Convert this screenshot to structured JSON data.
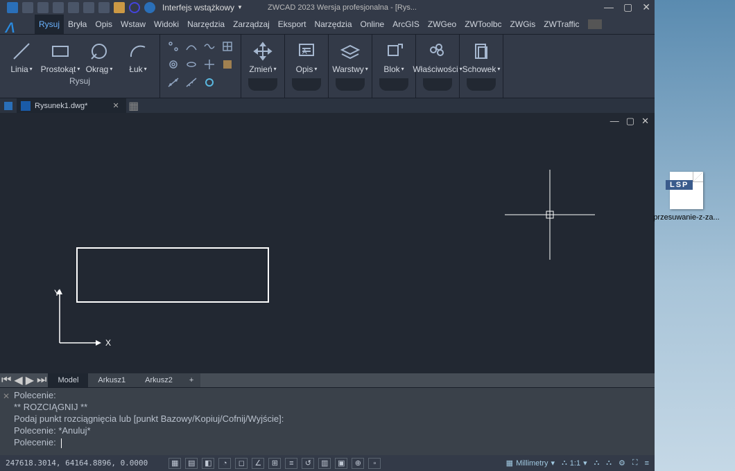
{
  "titlebar": {
    "dropdown_label": "Interfejs wstążkowy",
    "title": "ZWCAD 2023 Wersja profesjonalna - [Rys..."
  },
  "menu": [
    "Rysuj",
    "Bryła",
    "Opis",
    "Wstaw",
    "Widoki",
    "Narzędzia",
    "Zarządzaj",
    "Eksport",
    "Narzędzia",
    "Online",
    "ArcGIS",
    "ZWGeo",
    "ZWToolbc",
    "ZWGis",
    "ZWTraffic"
  ],
  "ribbon": {
    "draw_group_name": "Rysuj",
    "buttons": {
      "line": "Linia",
      "rectangle": "Prostokąt",
      "circle": "Okrąg",
      "arc": "Łuk",
      "modify": "Zmień",
      "annotation": "Opis",
      "layers": "Warstwy",
      "block": "Blok",
      "properties": "Właściwości",
      "clipboard": "Schowek"
    }
  },
  "file_tab": {
    "name": "Rysunek1.dwg*"
  },
  "sheet_tabs": {
    "model": "Model",
    "sheet1": "Arkusz1",
    "sheet2": "Arkusz2",
    "plus": "+"
  },
  "cmd": {
    "l1": "Polecenie:",
    "l2": "** ROZCIĄGNIJ **",
    "l3": "Podaj punkt rozciągnięcia lub [punkt Bazowy/Kopiuj/Cofnij/Wyjście]:",
    "l4": "Polecenie: *Anuluj*",
    "l5": "Polecenie: "
  },
  "status": {
    "coords": "247618.3014, 64164.8896, 0.0000",
    "units": "Millimetry",
    "scale": "1:1"
  },
  "ucs": {
    "x": "X",
    "y": "Y"
  },
  "desktop": {
    "lsp_badge": "LSP",
    "filename": "przesuwanie-z-za..."
  }
}
